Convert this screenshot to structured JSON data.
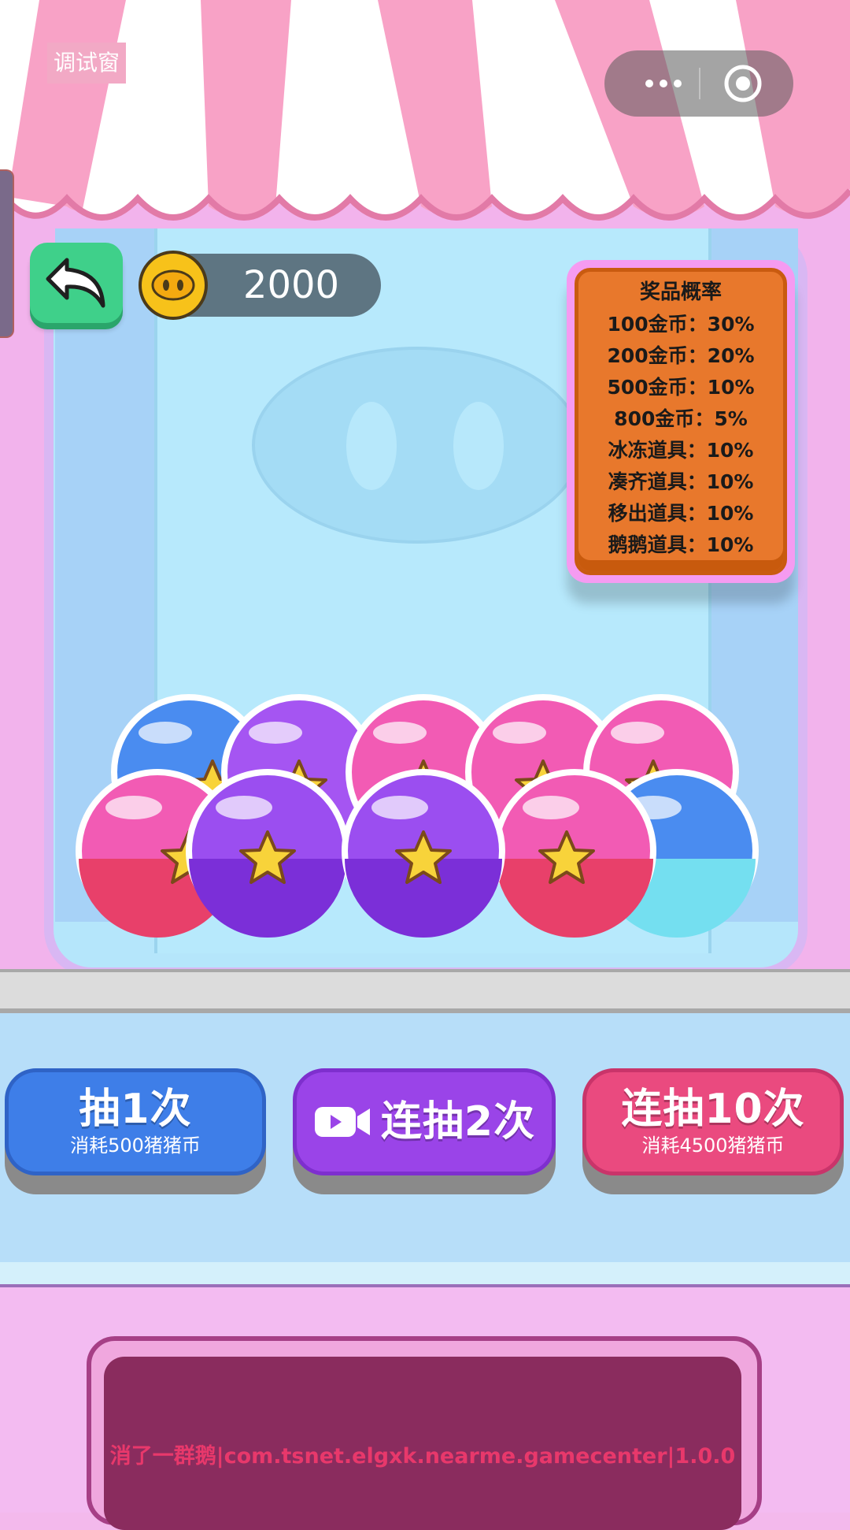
{
  "debug_badge": "调试窗",
  "header": {
    "coin_value": "2000"
  },
  "prize_probability": {
    "title": "奖品概率",
    "items": [
      "100金币：30%",
      "200金币：20%",
      "500金币：10%",
      "800金币：5%",
      "冰冻道具：10%",
      "凑齐道具：10%",
      "移出道具：10%",
      "鹅鹅道具：10%"
    ]
  },
  "buttons": {
    "draw_once": {
      "label": "抽1次",
      "cost": "消耗500猪猪币"
    },
    "draw_twice": {
      "label": "连抽2次"
    },
    "draw_ten": {
      "label": "连抽10次",
      "cost": "消耗4500猪猪币"
    }
  },
  "display_text": "消了一群鹅|com.tsnet.elgxk.nearme.gamecenter|1.0.0",
  "colors": {
    "blue_ball": "#4a8cf0",
    "purple_ball": "#9b4ef0",
    "pink_ball": "#f25bb4",
    "star": "#f8d33a"
  }
}
